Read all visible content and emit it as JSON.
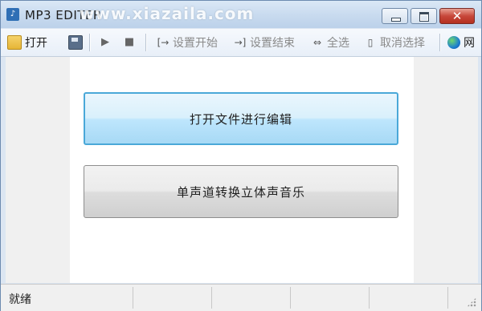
{
  "window": {
    "title": "MP3 EDITER",
    "watermark": "www.xiazaila.com",
    "icon": "music-note-icon"
  },
  "toolbar": {
    "open_label": "打开",
    "set_start_label": "设置开始",
    "set_end_label": "设置结束",
    "select_all_label": "全选",
    "cancel_select_label": "取消选择",
    "web_label": "网"
  },
  "main": {
    "open_edit_label": "打开文件进行编辑",
    "mono_to_stereo_label": "单声道转换立体声音乐"
  },
  "status": {
    "text": "就绪"
  },
  "colors": {
    "primary_border": "#4aa8d8",
    "close_red": "#c7473a",
    "titlebar": "#c9dbef"
  }
}
